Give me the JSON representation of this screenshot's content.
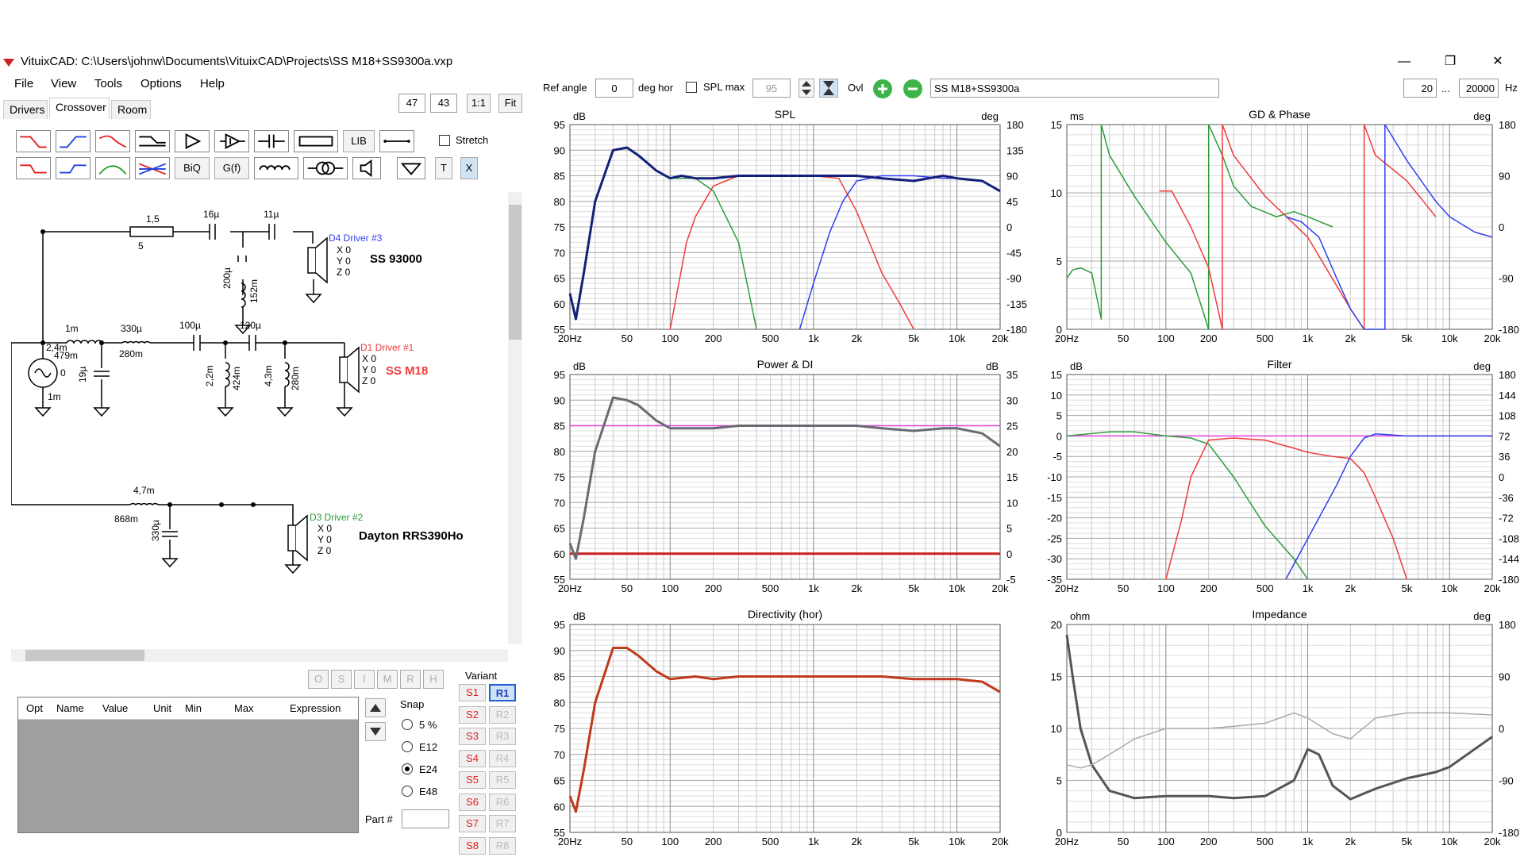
{
  "window": {
    "title": "VituixCAD: C:\\Users\\johnw\\Documents\\VituixCAD\\Projects\\SS M18+SS9300a.vxp",
    "minimize": "—",
    "restore": "❐",
    "close": "✕"
  },
  "menu": [
    "File",
    "View",
    "Tools",
    "Options",
    "Help"
  ],
  "tabs": [
    "Drivers",
    "Crossover",
    "Room"
  ],
  "zoom": {
    "a": "47",
    "b": "43",
    "one": "1:1",
    "fit": "Fit"
  },
  "toolbar": {
    "biq": "BiQ",
    "gf": "G(f)",
    "lib": "LIB",
    "t": "T",
    "x": "X",
    "stretch": "Stretch"
  },
  "topbar": {
    "ref_angle_label": "Ref angle",
    "ref_angle": "0",
    "deg_hor": "deg hor",
    "spl_max_label": "SPL max",
    "spl_max": "95",
    "ovl": "Ovl",
    "project": "SS M18+SS9300a",
    "fmin": "20",
    "ellipsis": "...",
    "fmax": "20000",
    "hz": "Hz"
  },
  "schematic": {
    "d4_label": "D4 Driver #3",
    "d4_xyz": [
      "X 0",
      "Y 0",
      "Z 0"
    ],
    "d4_name": "SS 93000",
    "d1_label": "D1 Driver #1",
    "d1_xyz": [
      "X 0",
      "Y 0",
      "Z 0"
    ],
    "d1_name": "SS M18",
    "d3_label": "D3 Driver #2",
    "d3_xyz": [
      "X 0",
      "Y 0",
      "Z 0"
    ],
    "d3_name": "Dayton RRS390Ho",
    "parts": {
      "r15": "1,5",
      "r5": "5",
      "c16": "16µ",
      "c11": "11µ",
      "c200": "200µ",
      "l152": "152m",
      "l1m": "1m",
      "l330": "330µ",
      "l280": "280m",
      "c100": "100µ",
      "c120": "120µ",
      "r22": "2,2m",
      "l424": "424m",
      "r43": "4,3m",
      "l280b": "280m",
      "r24": "2,4m",
      "r479": "479m",
      "v0": "0",
      "c19": "19µ",
      "l1mb": "1m",
      "l47": "4,7m",
      "l868": "868m",
      "c330": "330µ"
    }
  },
  "osi": [
    "O",
    "S",
    "I",
    "M",
    "R",
    "H"
  ],
  "table": {
    "cols": [
      "Opt",
      "Name",
      "Value",
      "Unit",
      "Min",
      "Max",
      "Expression"
    ]
  },
  "snap": {
    "label": "Snap",
    "options": [
      "5 %",
      "E12",
      "E24",
      "E48"
    ],
    "selected": "E24"
  },
  "part_label": "Part #",
  "variant": {
    "label": "Variant",
    "s": [
      "S1",
      "S2",
      "S3",
      "S4",
      "S5",
      "S6",
      "S7",
      "S8"
    ],
    "r": [
      "R1",
      "R2",
      "R3",
      "R4",
      "R5",
      "R6",
      "R7",
      "R8"
    ]
  },
  "colors": {
    "green": "#2e9b3a",
    "red": "#ef3b3b",
    "blue": "#2f3ff0",
    "navy": "#12207a",
    "magenta": "#e040e0",
    "darkred": "#c81e1e",
    "grey": "#6a6a72",
    "rust": "#c0391b"
  },
  "freq_ticks": [
    "20Hz",
    "50",
    "100",
    "200",
    "500",
    "1k",
    "2k",
    "5k",
    "10k",
    "20k"
  ],
  "chart_data": [
    {
      "type": "line",
      "title": "SPL",
      "ylabel": "dB",
      "y2label": "deg",
      "yticks": [
        "95",
        "90",
        "85",
        "80",
        "75",
        "70",
        "65",
        "60",
        "55"
      ],
      "y2ticks": [
        "180",
        "135",
        "90",
        "45",
        "0",
        "-45",
        "-90",
        "-135",
        "-180"
      ],
      "ylim": [
        55,
        95
      ],
      "xlim": [
        20,
        20000
      ],
      "series": [
        {
          "color": "green",
          "x": [
            20,
            22,
            25,
            30,
            40,
            50,
            60,
            80,
            100,
            150,
            200,
            300,
            400
          ],
          "y": [
            62,
            57,
            66,
            80,
            90,
            90.5,
            89,
            86,
            84.5,
            84.5,
            82,
            72,
            55
          ]
        },
        {
          "color": "red",
          "x": [
            100,
            130,
            150,
            200,
            300,
            500,
            800,
            1000,
            1500,
            2000,
            3000,
            4000,
            5000
          ],
          "y": [
            55,
            72,
            77,
            83,
            85,
            85,
            85,
            85,
            84.5,
            78,
            66,
            60,
            55
          ]
        },
        {
          "color": "blue",
          "x": [
            800,
            1000,
            1300,
            1600,
            2000,
            3000,
            5000,
            8000,
            10000,
            15000,
            20000
          ],
          "y": [
            55,
            64,
            74,
            80,
            84,
            85,
            85,
            84.5,
            84.5,
            84,
            82
          ]
        },
        {
          "color": "navy",
          "x": [
            20,
            22,
            25,
            30,
            40,
            50,
            60,
            80,
            100,
            120,
            150,
            200,
            300,
            500,
            800,
            1000,
            2000,
            3000,
            5000,
            8000,
            10000,
            15000,
            20000
          ],
          "y": [
            62,
            57,
            66,
            80,
            90,
            90.5,
            89,
            86,
            84.5,
            85,
            84.5,
            84.5,
            85,
            85,
            85,
            85,
            85,
            84.5,
            84,
            85,
            84.5,
            84,
            82
          ]
        }
      ]
    },
    {
      "type": "line",
      "title": "GD & Phase",
      "ylabel": "ms",
      "y2label": "deg",
      "yticks": [
        "15",
        "10",
        "5",
        "0"
      ],
      "y2ticks": [
        "180",
        "90",
        "0",
        "-90",
        "-180"
      ],
      "ylim": [
        -5,
        15
      ],
      "xlim": [
        20,
        20000
      ],
      "series": [
        {
          "color": "green",
          "x": [
            20,
            22,
            25,
            30,
            35,
            35,
            40,
            60,
            100,
            150,
            200,
            200,
            250,
            300,
            400,
            600,
            800,
            1000,
            1500
          ],
          "y": [
            0,
            0.8,
            1,
            0.5,
            -4,
            15,
            12,
            8,
            3.5,
            0.5,
            -5,
            15,
            12,
            9,
            7,
            6,
            6.5,
            6,
            5
          ]
        },
        {
          "color": "red",
          "x": [
            90,
            110,
            150,
            200,
            250,
            250,
            300,
            500,
            1000,
            2000,
            2500,
            2500,
            3000,
            5000,
            8000
          ],
          "y": [
            8.5,
            8.5,
            5,
            1,
            -5,
            15,
            12,
            8,
            4,
            -3,
            -5,
            15,
            12,
            9.5,
            6
          ]
        },
        {
          "color": "blue",
          "x": [
            700,
            900,
            1200,
            1600,
            2000,
            2500,
            3500,
            3500,
            5000,
            8000,
            10000,
            15000,
            20000
          ],
          "y": [
            6,
            5.5,
            4,
            0,
            -3,
            -5,
            -5,
            15,
            11.5,
            7.5,
            6,
            4.5,
            4
          ]
        }
      ]
    },
    {
      "type": "line",
      "title": "Power & DI",
      "ylabel": "dB",
      "y2label": "dB",
      "yticks": [
        "95",
        "90",
        "85",
        "80",
        "75",
        "70",
        "65",
        "60",
        "55"
      ],
      "y2ticks": [
        "35",
        "30",
        "25",
        "20",
        "15",
        "10",
        "5",
        "0",
        "-5"
      ],
      "ylim": [
        55,
        95
      ],
      "xlim": [
        20,
        20000
      ],
      "series": [
        {
          "color": "magenta",
          "x": [
            20,
            20000
          ],
          "y": [
            85,
            85
          ]
        },
        {
          "color": "darkred",
          "x": [
            20,
            20000
          ],
          "y": [
            60,
            60
          ]
        },
        {
          "color": "grey",
          "x": [
            20,
            22,
            25,
            30,
            40,
            50,
            60,
            80,
            100,
            150,
            200,
            300,
            500,
            1000,
            2000,
            3000,
            5000,
            8000,
            10000,
            15000,
            20000
          ],
          "y": [
            62,
            59,
            67,
            80,
            90.5,
            90,
            89,
            86,
            84.5,
            84.5,
            84.5,
            85,
            85,
            85,
            85,
            84.5,
            84,
            84.5,
            84.5,
            83.5,
            81
          ]
        }
      ]
    },
    {
      "type": "line",
      "title": "Filter",
      "ylabel": "dB",
      "y2label": "deg",
      "yticks": [
        "15",
        "10",
        "5",
        "0",
        "-5",
        "-10",
        "-15",
        "-20",
        "-25",
        "-30",
        "-35"
      ],
      "y2ticks": [
        "180",
        "144",
        "108",
        "72",
        "36",
        "0",
        "-36",
        "-72",
        "-108",
        "-144",
        "-180"
      ],
      "ylim": [
        -35,
        15
      ],
      "xlim": [
        20,
        20000
      ],
      "series": [
        {
          "color": "magenta",
          "x": [
            20,
            20000
          ],
          "y": [
            0,
            0
          ]
        },
        {
          "color": "green",
          "x": [
            20,
            40,
            60,
            100,
            150,
            200,
            300,
            500,
            800,
            1000
          ],
          "y": [
            0,
            1,
            1,
            0,
            -0.5,
            -2,
            -10,
            -22,
            -30,
            -35
          ]
        },
        {
          "color": "red",
          "x": [
            100,
            130,
            150,
            200,
            300,
            500,
            800,
            1000,
            1500,
            2000,
            2500,
            3000,
            4000,
            5000
          ],
          "y": [
            -35,
            -20,
            -10,
            -1,
            -0.5,
            -1,
            -3,
            -4,
            -5,
            -5.5,
            -9,
            -15,
            -25,
            -35
          ]
        },
        {
          "color": "blue",
          "x": [
            700,
            900,
            1200,
            1600,
            2000,
            2500,
            3000,
            5000,
            10000,
            20000
          ],
          "y": [
            -35,
            -28,
            -20,
            -12,
            -5,
            -0.5,
            0.5,
            0,
            0,
            0
          ]
        }
      ]
    },
    {
      "type": "line",
      "title": "Directivity (hor)",
      "ylabel": "dB",
      "yticks": [
        "95",
        "90",
        "85",
        "80",
        "75",
        "70",
        "65",
        "60",
        "55"
      ],
      "ylim": [
        55,
        95
      ],
      "xlim": [
        20,
        20000
      ],
      "series": [
        {
          "color": "rust",
          "x": [
            20,
            22,
            25,
            30,
            40,
            50,
            60,
            80,
            100,
            150,
            200,
            300,
            500,
            1000,
            2000,
            3000,
            5000,
            8000,
            10000,
            15000,
            20000
          ],
          "y": [
            62,
            59,
            67,
            80,
            90.5,
            90.5,
            89,
            86,
            84.5,
            85,
            84.5,
            85,
            85,
            85,
            85,
            85,
            84.5,
            84.5,
            84.5,
            84,
            82
          ]
        }
      ]
    },
    {
      "type": "line",
      "title": "Impedance",
      "ylabel": "ohm",
      "y2label": "deg",
      "yticks": [
        "20",
        "15",
        "10",
        "5",
        "0"
      ],
      "y2ticks": [
        "180",
        "90",
        "0",
        "-90",
        "-180"
      ],
      "ylim": [
        0,
        20
      ],
      "xlim": [
        20,
        20000
      ],
      "series": [
        {
          "color": "darkgrey",
          "x": [
            20,
            22,
            25,
            30,
            40,
            60,
            100,
            200,
            300,
            500,
            800,
            1000,
            1200,
            1500,
            2000,
            3000,
            5000,
            8000,
            10000,
            15000,
            20000
          ],
          "y": [
            19,
            15,
            10,
            6.5,
            4,
            3.3,
            3.5,
            3.5,
            3.3,
            3.5,
            5,
            8,
            7.5,
            4.5,
            3.2,
            4.2,
            5.2,
            5.8,
            6.3,
            8,
            9.2
          ]
        },
        {
          "color": "lightgrey",
          "x": [
            20,
            25,
            30,
            40,
            60,
            100,
            200,
            300,
            500,
            800,
            1000,
            1500,
            2000,
            3000,
            5000,
            10000,
            20000
          ],
          "y": [
            6.5,
            6.2,
            6.5,
            7.5,
            9,
            10,
            10,
            10.2,
            10.5,
            11.5,
            11,
            9.5,
            9,
            11,
            11.5,
            11.5,
            11.3
          ]
        }
      ]
    }
  ]
}
